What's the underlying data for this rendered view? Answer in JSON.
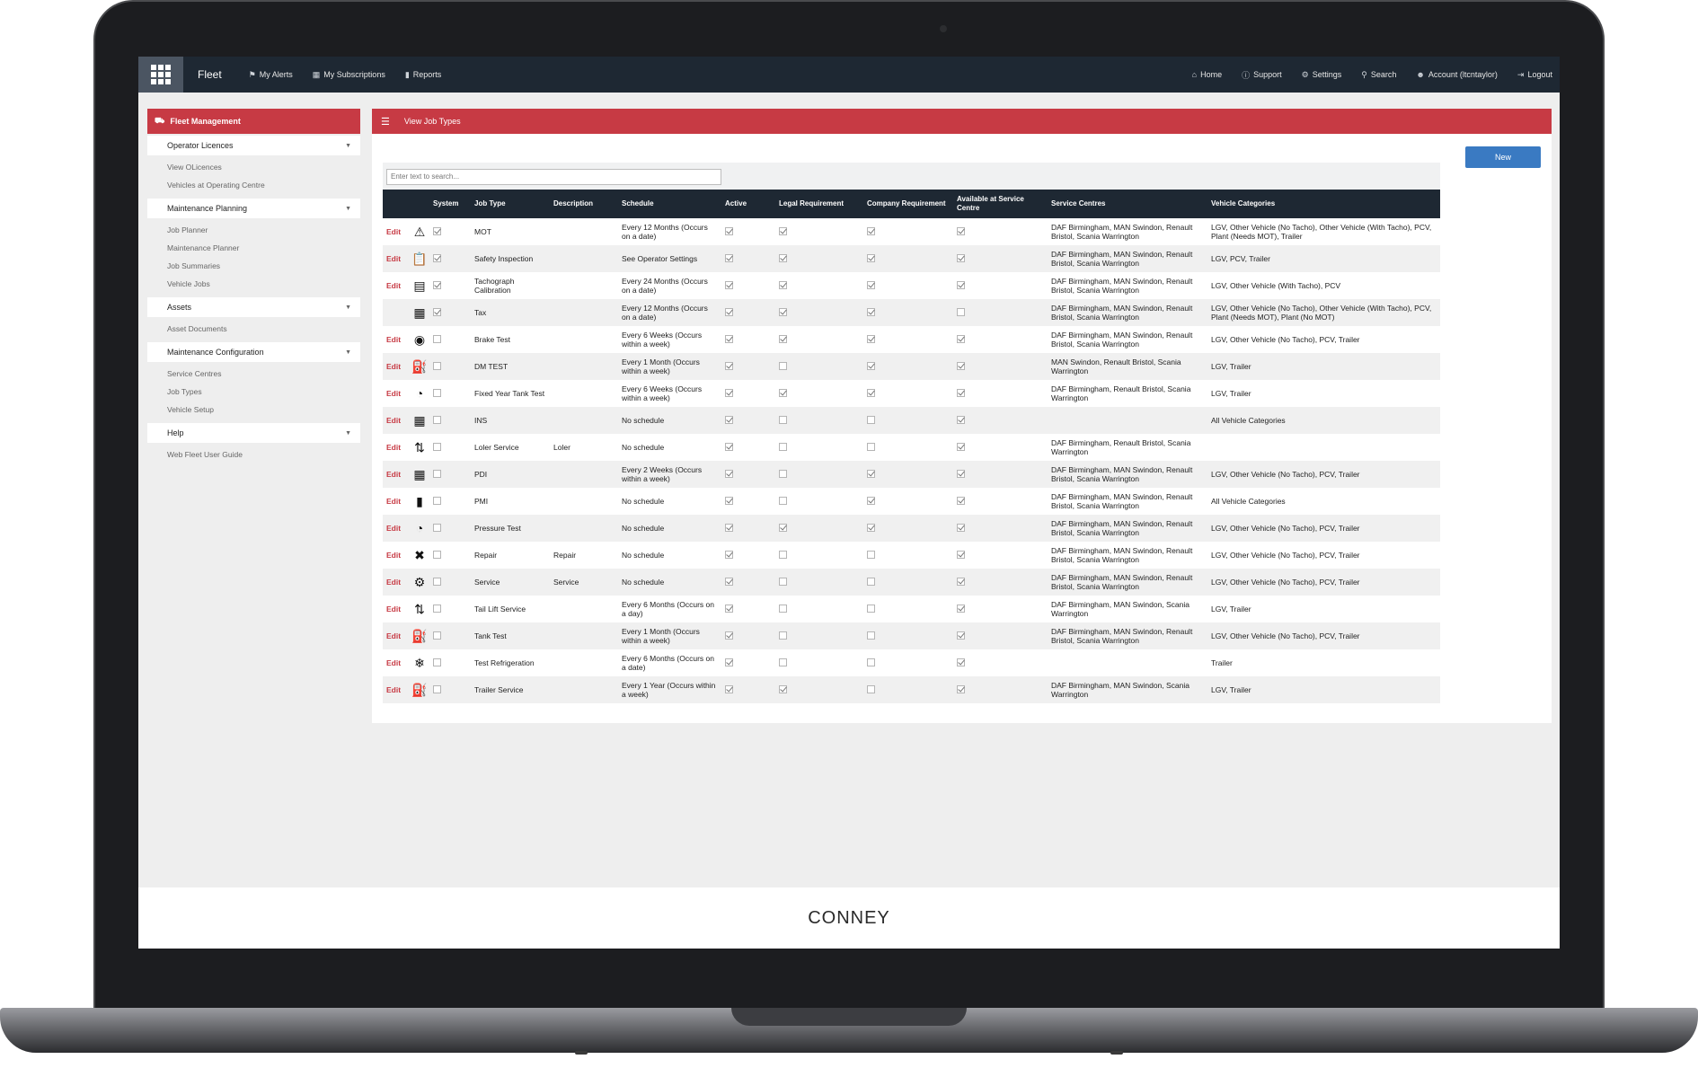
{
  "topnav": {
    "brand": "Fleet",
    "left_items": [
      {
        "label": "My Alerts",
        "icon": "flag-icon"
      },
      {
        "label": "My Subscriptions",
        "icon": "calendar-icon"
      },
      {
        "label": "Reports",
        "icon": "bar-chart-icon"
      }
    ],
    "right_items": [
      {
        "label": "Home",
        "icon": "home-icon"
      },
      {
        "label": "Support",
        "icon": "info-icon"
      },
      {
        "label": "Settings",
        "icon": "gear-icon"
      },
      {
        "label": "Search",
        "icon": "search-icon"
      },
      {
        "label": "Account (ltcntaylor)",
        "icon": "user-icon"
      },
      {
        "label": "Logout",
        "icon": "logout-icon"
      }
    ]
  },
  "sidebar": {
    "title": "Fleet Management",
    "sections": [
      {
        "label": "Operator Licences",
        "links": [
          "View OLicences",
          "Vehicles at Operating Centre"
        ]
      },
      {
        "label": "Maintenance Planning",
        "links": [
          "Job Planner",
          "Maintenance Planner",
          "Job Summaries",
          "Vehicle Jobs"
        ]
      },
      {
        "label": "Assets",
        "links": [
          "Asset Documents"
        ]
      },
      {
        "label": "Maintenance Configuration",
        "links": [
          "Service Centres",
          "Job Types",
          "Vehicle Setup"
        ]
      },
      {
        "label": "Help",
        "links": [
          "Web Fleet User Guide"
        ]
      }
    ]
  },
  "main": {
    "title": "View Job Types",
    "new_button": "New",
    "search_placeholder": "Enter text to search...",
    "columns": [
      "",
      "",
      "System",
      "Job Type",
      "Description",
      "Schedule",
      "Active",
      "Legal Requirement",
      "Company Requirement",
      "Available at Service Centre",
      "Service Centres",
      "Vehicle Categories"
    ],
    "rows": [
      {
        "edit": "Edit",
        "icon": "warning-triangle-icon",
        "glyph": "⚠",
        "system": true,
        "job_type": "MOT",
        "description": "",
        "schedule": "Every 12 Months (Occurs on a date)",
        "active": true,
        "legal": true,
        "company": true,
        "available": true,
        "service_centres": "DAF Birmingham, MAN Swindon, Renault Bristol, Scania Warrington",
        "vehicle_categories": "LGV, Other Vehicle (No Tacho), Other Vehicle (With Tacho), PCV, Plant (Needs MOT), Trailer"
      },
      {
        "edit": "Edit",
        "icon": "clipboard-icon",
        "glyph": "📋",
        "system": true,
        "job_type": "Safety Inspection",
        "description": "",
        "schedule": "See Operator Settings",
        "active": true,
        "legal": true,
        "company": true,
        "available": true,
        "service_centres": "DAF Birmingham, MAN Swindon, Renault Bristol, Scania Warrington",
        "vehicle_categories": "LGV, PCV, Trailer"
      },
      {
        "edit": "Edit",
        "icon": "tachograph-icon",
        "glyph": "▤",
        "system": true,
        "job_type": "Tachograph Calibration",
        "description": "",
        "schedule": "Every 24 Months (Occurs on a date)",
        "active": true,
        "legal": true,
        "company": true,
        "available": true,
        "service_centres": "DAF Birmingham, MAN Swindon, Renault Bristol, Scania Warrington",
        "vehicle_categories": "LGV, Other Vehicle (With Tacho), PCV"
      },
      {
        "edit": "",
        "icon": "tax-calendar-icon",
        "glyph": "▦",
        "system": true,
        "job_type": "Tax",
        "description": "",
        "schedule": "Every 12 Months (Occurs on a date)",
        "active": true,
        "legal": true,
        "company": true,
        "available": false,
        "service_centres": "DAF Birmingham, MAN Swindon, Renault Bristol, Scania Warrington",
        "vehicle_categories": "LGV, Other Vehicle (No Tacho), Other Vehicle (With Tacho), PCV, Plant (Needs MOT), Plant (No MOT)"
      },
      {
        "edit": "Edit",
        "icon": "brake-disc-icon",
        "glyph": "◉",
        "system": false,
        "job_type": "Brake Test",
        "description": "",
        "schedule": "Every 6 Weeks (Occurs within a week)",
        "active": true,
        "legal": true,
        "company": true,
        "available": true,
        "service_centres": "DAF Birmingham, MAN Swindon, Renault Bristol, Scania Warrington",
        "vehicle_categories": "LGV, Other Vehicle (No Tacho), PCV, Trailer"
      },
      {
        "edit": "Edit",
        "icon": "oil-can-icon",
        "glyph": "⛽",
        "system": false,
        "job_type": "DM TEST",
        "description": "",
        "schedule": "Every 1 Month (Occurs within a week)",
        "active": true,
        "legal": false,
        "company": true,
        "available": true,
        "service_centres": "MAN Swindon, Renault Bristol, Scania Warrington",
        "vehicle_categories": "LGV, Trailer"
      },
      {
        "edit": "Edit",
        "icon": "gauge-icon",
        "glyph": "◔",
        "system": false,
        "job_type": "Fixed Year Tank Test",
        "description": "",
        "schedule": "Every 6 Weeks (Occurs within a week)",
        "active": true,
        "legal": true,
        "company": true,
        "available": true,
        "service_centres": "DAF Birmingham, Renault Bristol, Scania Warrington",
        "vehicle_categories": "LGV, Trailer"
      },
      {
        "edit": "Edit",
        "icon": "calendar-icon",
        "glyph": "▦",
        "system": false,
        "job_type": "INS",
        "description": "",
        "schedule": "No schedule",
        "active": true,
        "legal": false,
        "company": false,
        "available": true,
        "service_centres": "",
        "vehicle_categories": "All Vehicle Categories"
      },
      {
        "edit": "Edit",
        "icon": "lift-icon",
        "glyph": "⇅",
        "system": false,
        "job_type": "Loler Service",
        "description": "Loler",
        "schedule": "No schedule",
        "active": true,
        "legal": false,
        "company": false,
        "available": true,
        "service_centres": "DAF Birmingham, Renault Bristol, Scania Warrington",
        "vehicle_categories": ""
      },
      {
        "edit": "Edit",
        "icon": "calendar-icon",
        "glyph": "▦",
        "system": false,
        "job_type": "PDI",
        "description": "",
        "schedule": "Every 2 Weeks (Occurs within a week)",
        "active": true,
        "legal": false,
        "company": true,
        "available": true,
        "service_centres": "DAF Birmingham, MAN Swindon, Renault Bristol, Scania Warrington",
        "vehicle_categories": "LGV, Other Vehicle (No Tacho), PCV, Trailer"
      },
      {
        "edit": "Edit",
        "icon": "battery-icon",
        "glyph": "▮",
        "system": false,
        "job_type": "PMI",
        "description": "",
        "schedule": "No schedule",
        "active": true,
        "legal": false,
        "company": true,
        "available": true,
        "service_centres": "DAF Birmingham, MAN Swindon, Renault Bristol, Scania Warrington",
        "vehicle_categories": "All Vehicle Categories"
      },
      {
        "edit": "Edit",
        "icon": "gauge-icon",
        "glyph": "◔",
        "system": false,
        "job_type": "Pressure Test",
        "description": "",
        "schedule": "No schedule",
        "active": true,
        "legal": true,
        "company": true,
        "available": true,
        "service_centres": "DAF Birmingham, MAN Swindon, Renault Bristol, Scania Warrington",
        "vehicle_categories": "LGV, Other Vehicle (No Tacho), PCV, Trailer"
      },
      {
        "edit": "Edit",
        "icon": "tools-icon",
        "glyph": "✖",
        "system": false,
        "job_type": "Repair",
        "description": "Repair",
        "schedule": "No schedule",
        "active": true,
        "legal": false,
        "company": false,
        "available": true,
        "service_centres": "DAF Birmingham, MAN Swindon, Renault Bristol, Scania Warrington",
        "vehicle_categories": "LGV, Other Vehicle (No Tacho), PCV, Trailer"
      },
      {
        "edit": "Edit",
        "icon": "engine-icon",
        "glyph": "⚙",
        "system": false,
        "job_type": "Service",
        "description": "Service",
        "schedule": "No schedule",
        "active": true,
        "legal": false,
        "company": false,
        "available": true,
        "service_centres": "DAF Birmingham, MAN Swindon, Renault Bristol, Scania Warrington",
        "vehicle_categories": "LGV, Other Vehicle (No Tacho), PCV, Trailer"
      },
      {
        "edit": "Edit",
        "icon": "lift-icon",
        "glyph": "⇅",
        "system": false,
        "job_type": "Tail Lift Service",
        "description": "",
        "schedule": "Every 6 Months (Occurs on a day)",
        "active": true,
        "legal": false,
        "company": false,
        "available": true,
        "service_centres": "DAF Birmingham, MAN Swindon, Scania Warrington",
        "vehicle_categories": "LGV, Trailer"
      },
      {
        "edit": "Edit",
        "icon": "oil-can-icon",
        "glyph": "⛽",
        "system": false,
        "job_type": "Tank Test",
        "description": "",
        "schedule": "Every 1 Month (Occurs within a week)",
        "active": true,
        "legal": false,
        "company": false,
        "available": true,
        "service_centres": "DAF Birmingham, MAN Swindon, Renault Bristol, Scania Warrington",
        "vehicle_categories": "LGV, Other Vehicle (No Tacho), PCV, Trailer"
      },
      {
        "edit": "Edit",
        "icon": "snowflake-icon",
        "glyph": "❄",
        "system": false,
        "job_type": "Test Refrigeration",
        "description": "",
        "schedule": "Every 6 Months (Occurs on a date)",
        "active": true,
        "legal": false,
        "company": false,
        "available": true,
        "service_centres": "",
        "vehicle_categories": "Trailer"
      },
      {
        "edit": "Edit",
        "icon": "oil-can-icon",
        "glyph": "⛽",
        "system": false,
        "job_type": "Trailer Service",
        "description": "",
        "schedule": "Every 1 Year (Occurs within a week)",
        "active": true,
        "legal": true,
        "company": false,
        "available": true,
        "service_centres": "DAF Birmingham, MAN Swindon, Scania Warrington",
        "vehicle_categories": "LGV, Trailer"
      }
    ]
  },
  "footer": {
    "logo_text": "CONNEY"
  }
}
